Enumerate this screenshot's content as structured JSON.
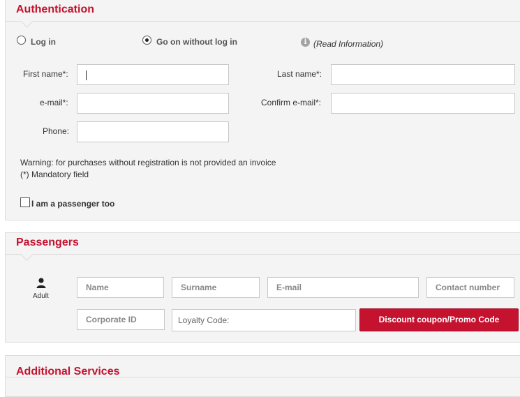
{
  "authentication": {
    "title": "Authentication",
    "radio_login": "Log in",
    "radio_guest": "Go on without log in",
    "selected_mode": "Go on without log in",
    "read_info": "(Read Information)",
    "first_name_label": "First name*:",
    "last_name_label": "Last name*:",
    "email_label": "e-mail*:",
    "confirm_email_label": "Confirm e-mail*:",
    "phone_label": "Phone:",
    "first_name_value": "",
    "last_name_value": "",
    "email_value": "",
    "confirm_email_value": "",
    "phone_value": "",
    "warning": "Warning: for purchases without registration is not provided an invoice",
    "mandatory": "(*) Mandatory field",
    "passenger_too": "I am a passenger too",
    "passenger_too_checked": false
  },
  "passengers": {
    "title": "Passengers",
    "type_label": "Adult",
    "name_placeholder": "Name",
    "surname_placeholder": "Surname",
    "email_placeholder": "E-mail",
    "contact_placeholder": "Contact number",
    "corporate_placeholder": "Corporate ID",
    "loyalty_placeholder": "Loyalty Code:",
    "discount_button": "Discount coupon/Promo Code"
  },
  "additional": {
    "title": "Additional Services"
  },
  "colors": {
    "accent": "#c4122f",
    "panel_bg": "#f4f4f4",
    "border": "#dcdcdc"
  }
}
